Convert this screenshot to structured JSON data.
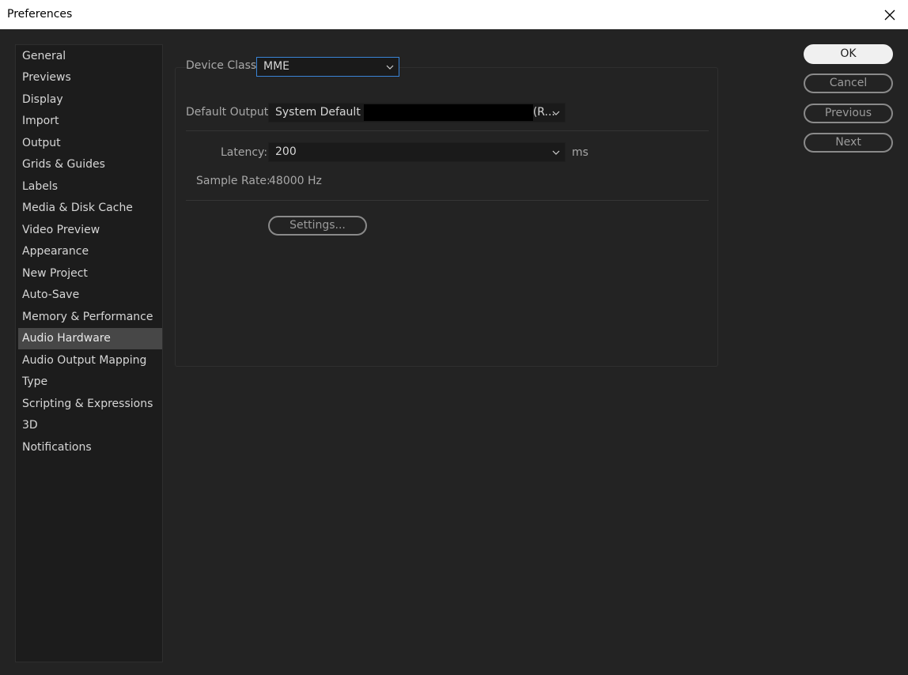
{
  "window": {
    "title": "Preferences"
  },
  "sidebar": {
    "items": [
      {
        "label": "General"
      },
      {
        "label": "Previews"
      },
      {
        "label": "Display"
      },
      {
        "label": "Import"
      },
      {
        "label": "Output"
      },
      {
        "label": "Grids & Guides"
      },
      {
        "label": "Labels"
      },
      {
        "label": "Media & Disk Cache"
      },
      {
        "label": "Video Preview"
      },
      {
        "label": "Appearance"
      },
      {
        "label": "New Project"
      },
      {
        "label": "Auto-Save"
      },
      {
        "label": "Memory & Performance"
      },
      {
        "label": "Audio Hardware",
        "selected": true
      },
      {
        "label": "Audio Output Mapping"
      },
      {
        "label": "Type"
      },
      {
        "label": "Scripting & Expressions"
      },
      {
        "label": "3D"
      },
      {
        "label": "Notifications"
      }
    ]
  },
  "audio": {
    "device_class_label": "Device Class:",
    "device_class_value": "MME",
    "default_output_label": "Default Output:",
    "default_output_value_start": "System Default",
    "default_output_value_end": "(R...",
    "latency_label": "Latency:",
    "latency_value": "200",
    "latency_unit": "ms",
    "sample_rate_label": "Sample Rate:",
    "sample_rate_value": "48000 Hz",
    "settings_button": "Settings..."
  },
  "buttons": {
    "ok": "OK",
    "cancel": "Cancel",
    "previous": "Previous",
    "next": "Next"
  }
}
